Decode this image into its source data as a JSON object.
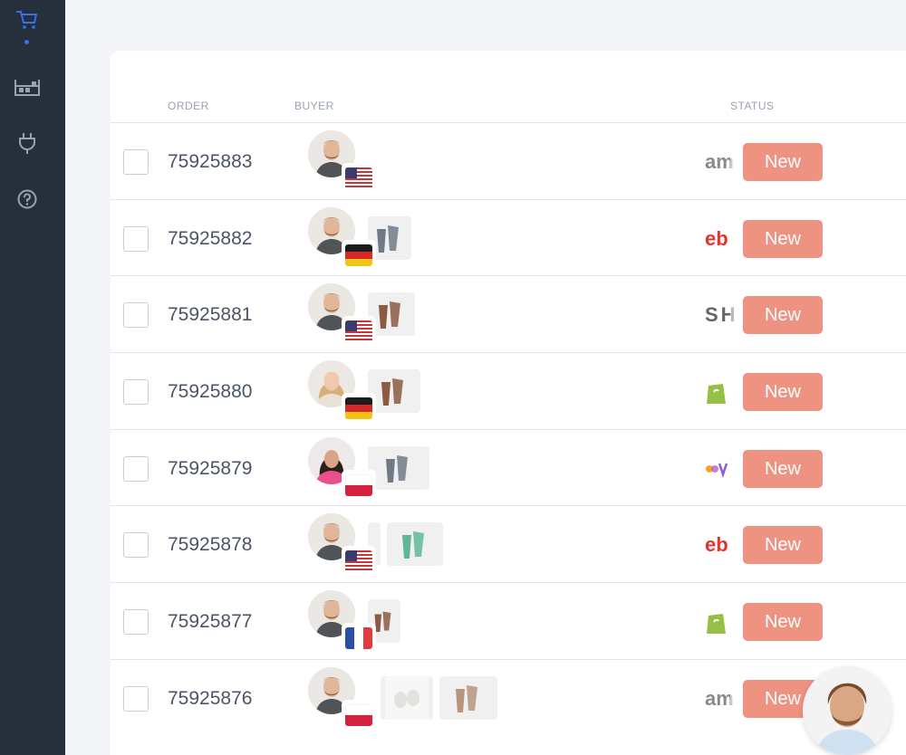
{
  "sidebar": {
    "items": [
      {
        "icon": "cart-icon",
        "active": true,
        "color": "#3d6df0"
      },
      {
        "icon": "warehouse-icon",
        "active": false
      },
      {
        "icon": "plug-icon",
        "active": false
      },
      {
        "icon": "help-icon",
        "active": false
      }
    ]
  },
  "table": {
    "columns": {
      "order": "ORDER",
      "buyer": "BUYER",
      "status": "STATUS"
    },
    "rows": [
      {
        "order": "75925883",
        "buyer_gender": "male",
        "country": "US",
        "products": [],
        "marketplace": "amazon",
        "status": "New"
      },
      {
        "order": "75925882",
        "buyer_gender": "male",
        "country": "DE",
        "products": [
          "grey-cup"
        ],
        "marketplace": "ebay",
        "status": "New"
      },
      {
        "order": "75925881",
        "buyer_gender": "male",
        "country": "US",
        "products": [
          "brown-cup"
        ],
        "marketplace": "shein",
        "status": "New"
      },
      {
        "order": "75925880",
        "buyer_gender": "female",
        "country": "DE",
        "products": [
          "brown-cup"
        ],
        "marketplace": "shopify",
        "status": "New"
      },
      {
        "order": "75925879",
        "buyer_gender": "female",
        "country": "PL",
        "products": [
          "grey-cup"
        ],
        "marketplace": "wish",
        "status": "New"
      },
      {
        "order": "75925878",
        "buyer_gender": "male",
        "country": "US",
        "products": [
          "partial",
          "green-cup"
        ],
        "marketplace": "ebay",
        "status": "New"
      },
      {
        "order": "75925877",
        "buyer_gender": "male",
        "country": "FR",
        "products": [
          "brown-cup"
        ],
        "marketplace": "shopify",
        "status": "New"
      },
      {
        "order": "75925876",
        "buyer_gender": "male",
        "country": "PL",
        "products": [
          "white-mugs",
          "beige-cup"
        ],
        "marketplace": "amazon",
        "status": "New"
      }
    ]
  },
  "marketplace_labels": {
    "amazon": "am",
    "ebay": "eb",
    "shein": "SH"
  },
  "colors": {
    "status_new": "#ee9282",
    "sidebar_bg": "#26303d",
    "accent": "#3d6df0"
  },
  "chat": {
    "icon": "support-agent-avatar"
  }
}
